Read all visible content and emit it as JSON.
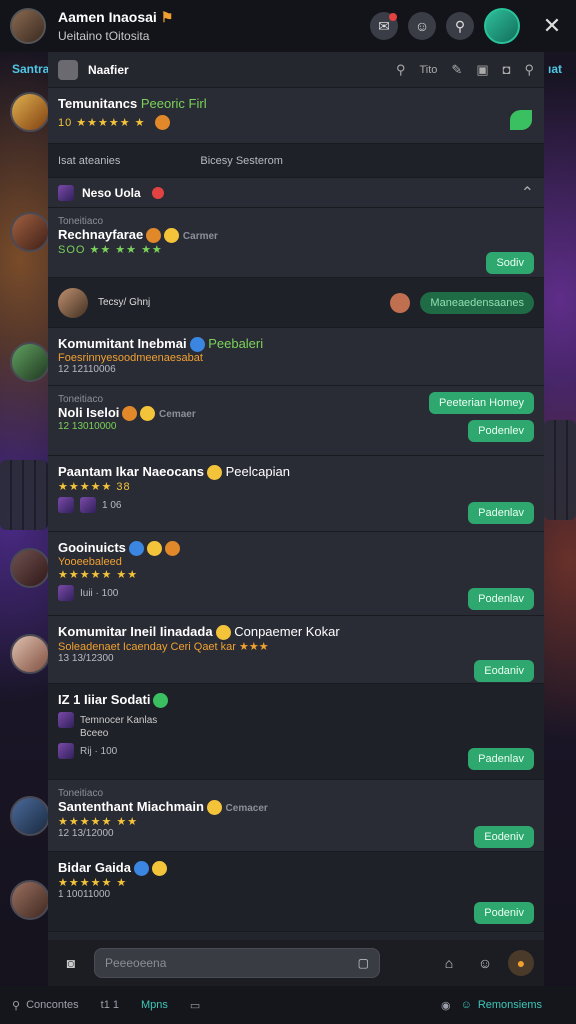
{
  "topbar": {
    "title": "Aamen Inaosai",
    "subtitle": "Ueitaino tOitosita",
    "badge": "⚑"
  },
  "side": {
    "left_tab": "Santra",
    "right_tab": "ıat"
  },
  "panel": {
    "header_title": "Naafier",
    "header_count": "Tito",
    "banner": {
      "title": "Temunitancs",
      "title_green": "Peeoric Firl",
      "stars": "10 ★★★★★ ★"
    },
    "tabs": {
      "left": "Isat ateanies",
      "right": "Bicesy Sesterom"
    },
    "new_section": "Neso Uola",
    "cards": [
      {
        "meta": "Toneitiaco",
        "title": "Rechnayfarae",
        "extra": "Carmer",
        "stars": "SOO ★★ ★★ ★★",
        "button": "Sodiv"
      },
      {
        "meta": "Tecsy/ Ghnj",
        "reply": "Maneaedensaanes"
      },
      {
        "title": "Komumitant Inebmai",
        "title_green": "Peebaleri",
        "orange": "Foesrinnyesoodmeenaesabat",
        "stamp": "12 12110006"
      },
      {
        "meta": "Toneitiaco",
        "title": "Noli Iseloi",
        "extra": "Cemaer",
        "stamp": "12 13010000",
        "button_top": "Peeterian Homey",
        "button": "Podenlev"
      },
      {
        "title": "Paantam Ikar Naeocans",
        "extra": "Peelcapian",
        "stars": "★★★★★ 38",
        "stamp": "1 06",
        "button": "Padenlav"
      },
      {
        "title": "Gooinuicts",
        "orange": "Yooeebaleed",
        "stars": "★★★★★ ★★",
        "stamp": "Iuii · 100",
        "button": "Podenlav"
      },
      {
        "title": "Komumitar Ineil Iinadada",
        "extra": "Conpaemer Kokar",
        "orange": "Soleadenaet Icaenday Ceri Qaet kar ★★★",
        "stamp": "13 13/12300",
        "button": "Eodaniv"
      },
      {
        "title": "IZ 1 Iiiar Sodati",
        "sub": "Temnocer Kanlas",
        "sub2": "Bceeo",
        "stamp": "Rij · 100",
        "button": "Padenlav"
      },
      {
        "meta": "Toneitiaco",
        "title": "Santenthant Miachmain",
        "extra": "Cemacer",
        "stars": "★★★★★ ★★",
        "stamp": "12 13/12000",
        "button": "Eodeniv"
      },
      {
        "title": "Bidar Gaida",
        "stars": "★★★★★ ★",
        "stamp": "1 10011000",
        "button": "Podeniv"
      }
    ]
  },
  "input": {
    "placeholder": "Peeeoeena"
  },
  "bottom": {
    "search": "Concontes",
    "count": "t1 1",
    "tab_mid": "Mpns",
    "tab_right": "Remonsiems"
  }
}
